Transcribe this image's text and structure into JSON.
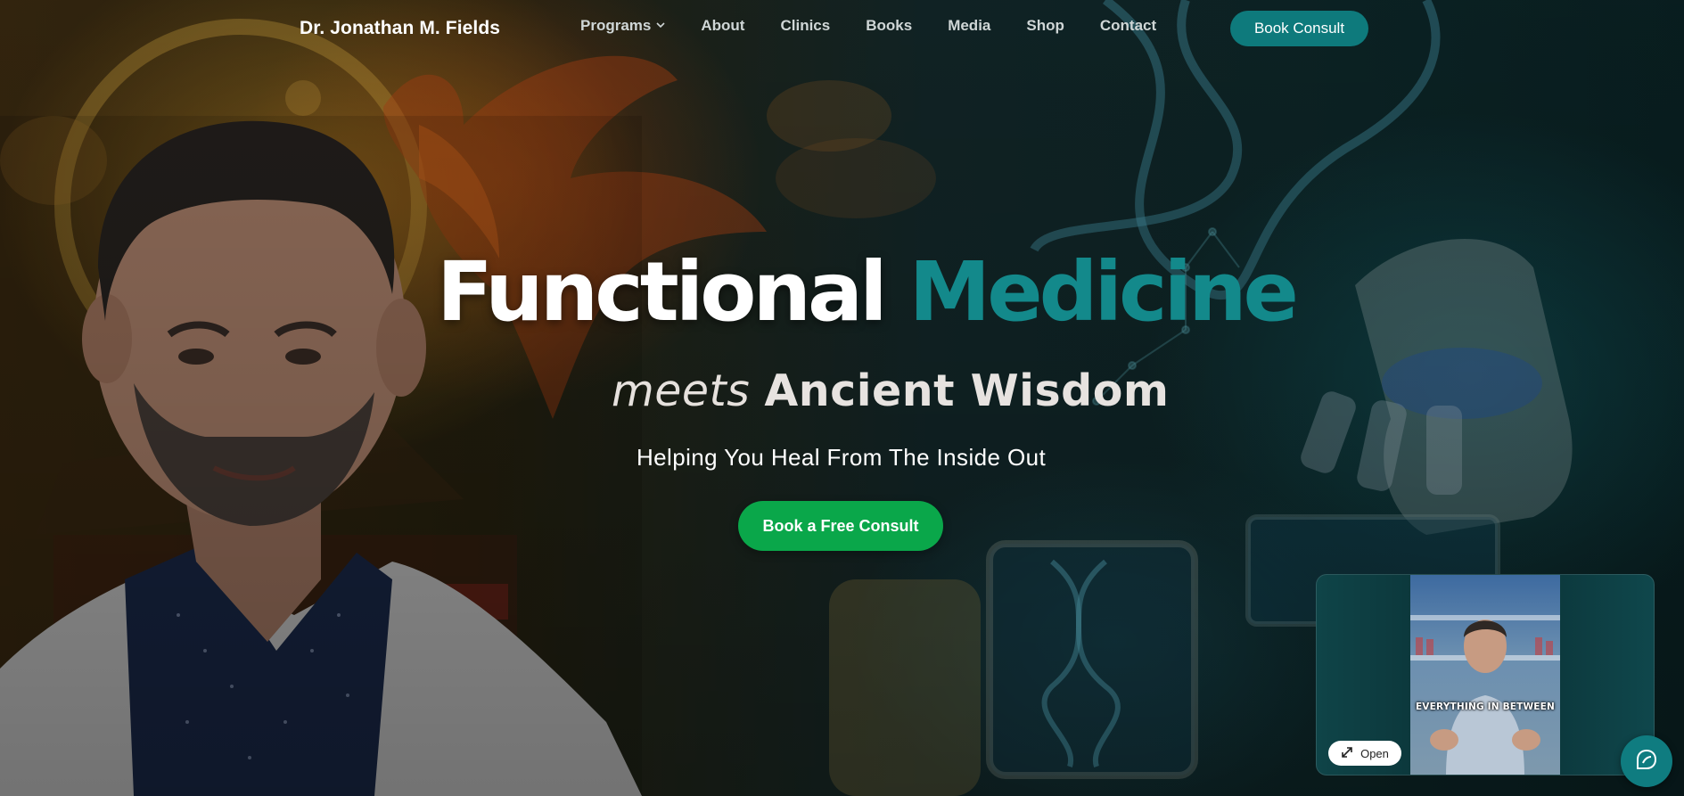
{
  "nav": {
    "brand": "Dr. Jonathan M. Fields",
    "links": [
      {
        "label": "Programs",
        "has_dropdown": true
      },
      {
        "label": "About"
      },
      {
        "label": "Clinics"
      },
      {
        "label": "Books"
      },
      {
        "label": "Media"
      },
      {
        "label": "Shop"
      },
      {
        "label": "Contact"
      }
    ],
    "book_consult": "Book Consult"
  },
  "hero": {
    "title_word1": "Functional",
    "title_word2": "Medicine",
    "sub_meets": "meets",
    "sub_ancient": "Ancient Wisdom",
    "tagline": "Helping You Heal From The Inside Out",
    "cta": "Book a Free Consult"
  },
  "video_widget": {
    "caption": "EVERYTHING IN BETWEEN",
    "open_label": "Open",
    "expand_icon": "expand-icon"
  },
  "chat": {
    "icon": "chat-icon"
  },
  "colors": {
    "accent_teal": "#13898b",
    "button_teal": "#0e7a7c",
    "cta_green": "#0aa74a"
  }
}
